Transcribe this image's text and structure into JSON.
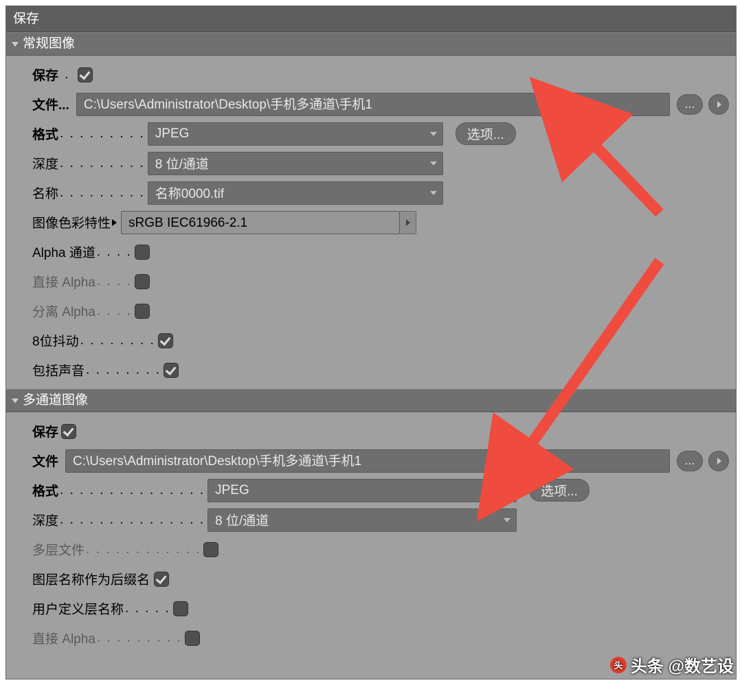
{
  "window": {
    "title": "保存"
  },
  "section1": {
    "title": "常规图像",
    "save_label": "保存",
    "save_checked": true,
    "file_label": "文件...",
    "file_path": "C:\\Users\\Administrator\\Desktop\\手机多通道\\手机1",
    "browse_label": "...",
    "format_label": "格式",
    "format_value": "JPEG",
    "options_button": "选项...",
    "depth_label": "深度",
    "depth_value": "8 位/通道",
    "name_label": "名称",
    "name_value": "名称0000.tif",
    "icc_label": "图像色彩特性",
    "icc_value": "sRGB IEC61966-2.1",
    "alpha_label": "Alpha 通道",
    "alpha_checked": false,
    "direct_alpha_label": "直接 Alpha",
    "direct_alpha_checked": false,
    "split_alpha_label": "分离 Alpha",
    "split_alpha_checked": false,
    "dither_label": "8位抖动",
    "dither_checked": true,
    "sound_label": "包括声音",
    "sound_checked": true
  },
  "section2": {
    "title": "多通道图像",
    "save_label": "保存",
    "save_checked": true,
    "file_label": "文件",
    "file_path": "C:\\Users\\Administrator\\Desktop\\手机多通道\\手机1",
    "browse_label": "...",
    "format_label": "格式",
    "format_value": "JPEG",
    "options_button": "选项...",
    "depth_label": "深度",
    "depth_value": "8 位/通道",
    "multilayer_label": "多层文件",
    "multilayer_checked": false,
    "layer_suffix_label": "图层名称作为后缀名",
    "layer_suffix_checked": true,
    "user_layer_label": "用户定义层名称",
    "user_layer_checked": false,
    "direct_alpha_label": "直接 Alpha",
    "direct_alpha_checked": false
  },
  "watermark": {
    "badge": "头",
    "text": "头条 @数艺设"
  }
}
